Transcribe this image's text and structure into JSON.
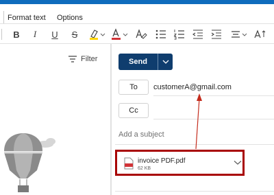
{
  "menu": {
    "format_text": "Format text",
    "options": "Options"
  },
  "ribbon": {
    "bold": "B",
    "italic": "I",
    "underline": "U",
    "strike": "S",
    "icons": [
      "bold-icon",
      "italic-icon",
      "underline-icon",
      "strikethrough-icon",
      "highlight-icon",
      "font-color-icon",
      "clear-formatting-icon",
      "bullets-icon",
      "numbering-icon",
      "decrease-indent-icon",
      "increase-indent-icon",
      "align-icon",
      "more-format-icon"
    ],
    "colors": {
      "highlight": "#ffd600",
      "font_color": "#d13438",
      "accent": "#0f6cbd",
      "send": "#0f3d6e",
      "callout": "#a80000"
    }
  },
  "list_pane": {
    "filter_label": "Filter"
  },
  "compose": {
    "send_label": "Send",
    "to_label": "To",
    "to_value": "customerA@gmail.com",
    "cc_label": "Cc",
    "subject_placeholder": "Add a subject",
    "attachment": {
      "name": "invoice PDF.pdf",
      "size": "62 KB"
    }
  }
}
